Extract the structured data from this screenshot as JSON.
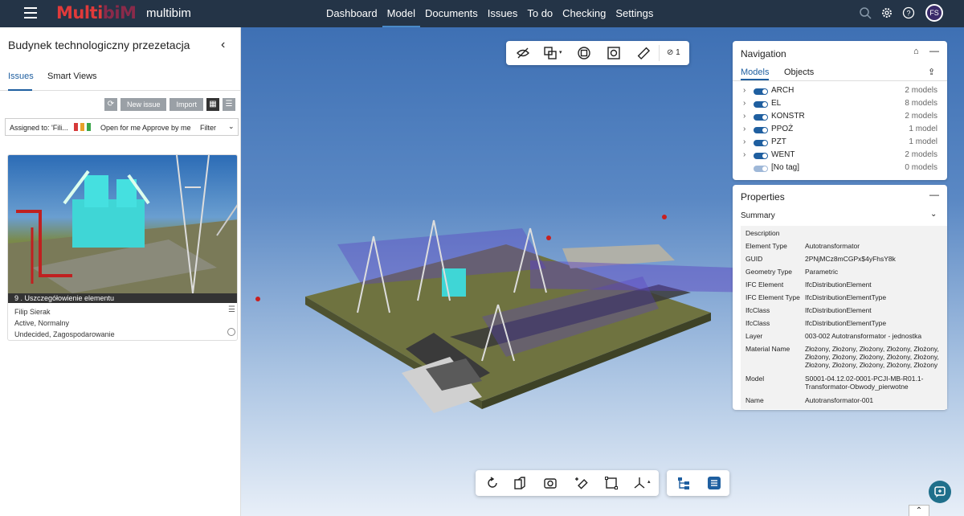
{
  "header": {
    "logo_text_a": "Multi",
    "logo_text_b": "biM",
    "app_name": "multibim",
    "nav": [
      "Dashboard",
      "Model",
      "Documents",
      "Issues",
      "To do",
      "Checking",
      "Settings"
    ],
    "active_nav": "Model",
    "avatar_initials": "FS",
    "icons": [
      "search-icon",
      "gear-icon",
      "help-icon"
    ]
  },
  "left_panel": {
    "title": "Budynek technologiczny przezetacja",
    "tabs": [
      "Issues",
      "Smart Views"
    ],
    "buttons": {
      "new_issue": "New issue",
      "import": "Import"
    },
    "filter": {
      "assigned": "Assigned to: 'Fili...",
      "open_for_me": "Open for me",
      "approve_by_me": "Approve by me",
      "filter_label": "Filter"
    },
    "issue": {
      "caption": "9 . Uszczegółowienie elementu",
      "author": "Filip Sierak",
      "status": "Active, Normalny",
      "resolution": "Undecided, Zagospodarowanie"
    }
  },
  "viewport": {
    "top_toolbar_count": "1",
    "top_toolbar_icons": [
      "hide-icon",
      "layers-icon",
      "isolate-icon",
      "fit-icon",
      "measure-icon"
    ],
    "bottom_toolbar_icons": [
      "rotate-icon",
      "section-icon",
      "camera-icon",
      "annotate-icon",
      "frame-icon",
      "axis-icon",
      "tree-icon",
      "list-icon"
    ]
  },
  "navigation": {
    "title": "Navigation",
    "tabs": [
      "Models",
      "Objects"
    ],
    "models": [
      {
        "name": "ARCH",
        "count": "2 models",
        "on": true
      },
      {
        "name": "EL",
        "count": "8 models",
        "on": true
      },
      {
        "name": "KONSTR",
        "count": "2 models",
        "on": true
      },
      {
        "name": "PPOŻ",
        "count": "1 model",
        "on": true
      },
      {
        "name": "PZT",
        "count": "1 model",
        "on": true
      },
      {
        "name": "WENT",
        "count": "2 models",
        "on": true
      },
      {
        "name": "[No tag]",
        "count": "0 models",
        "on": false
      }
    ]
  },
  "properties": {
    "title": "Properties",
    "section": "Summary",
    "rows": [
      {
        "k": "Description",
        "v": ""
      },
      {
        "k": "Element Type",
        "v": "Autotransformator"
      },
      {
        "k": "GUID",
        "v": "2PNjMCz8mCGPx$4yFhsY8k"
      },
      {
        "k": "Geometry Type",
        "v": "Parametric"
      },
      {
        "k": "IFC Element",
        "v": "IfcDistributionElement"
      },
      {
        "k": "IFC Element Type",
        "v": "IfcDistributionElementType"
      },
      {
        "k": "IfcClass",
        "v": "IfcDistributionElement"
      },
      {
        "k": "IfcClass",
        "v": "IfcDistributionElementType"
      },
      {
        "k": "Layer",
        "v": "003-002 Autotransformator - jednostka"
      },
      {
        "k": "Material Name",
        "v": "Złożony, Złożony, Złożony, Złożony, Złożony, Złożony, Złożony, Złożony, Złożony, Złożony, Złożony, Złożony, Złożony, Złożony, Złożony"
      },
      {
        "k": "Model",
        "v": "S0001-04.12.02-0001-PCJI-MB-R01.1-Transformator-Obwody_pierwotne"
      },
      {
        "k": "Name",
        "v": "Autotransformator-001"
      }
    ]
  }
}
